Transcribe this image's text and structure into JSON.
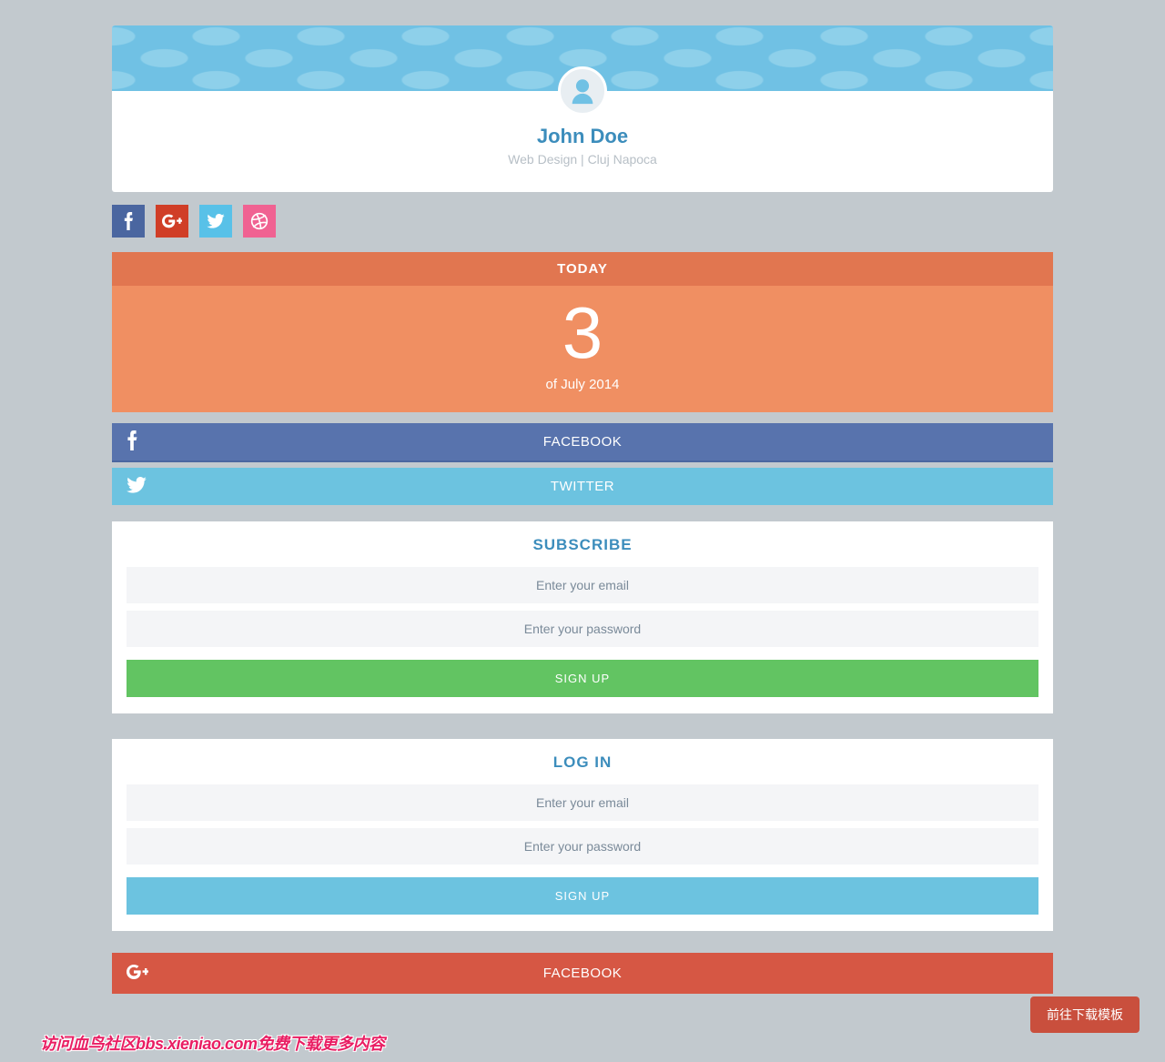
{
  "profile": {
    "name": "John Doe",
    "subtitle": "Web Design | Cluj Napoca"
  },
  "today": {
    "label": "TODAY",
    "day": "3",
    "sub": "of July 2014"
  },
  "bars": {
    "facebook": "FACEBOOK",
    "twitter": "TWITTER",
    "red_facebook": "FACEBOOK"
  },
  "subscribe": {
    "title": "SUBSCRIBE",
    "email_ph": "Enter your email",
    "password_ph": "Enter your password",
    "button": "SIGN UP"
  },
  "login": {
    "title": "LOG IN",
    "email_ph": "Enter your email",
    "password_ph": "Enter your password",
    "button": "SIGN UP"
  },
  "float_button": "前往下载模板",
  "watermark": "访问血鸟社区bbs.xieniao.com免费下载更多内容"
}
